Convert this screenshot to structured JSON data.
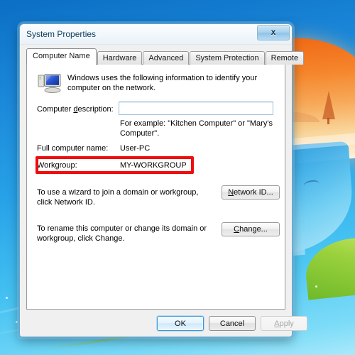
{
  "window": {
    "title": "System Properties",
    "close_label": "x"
  },
  "tabs": [
    {
      "label": "Computer Name",
      "active": true
    },
    {
      "label": "Hardware",
      "active": false
    },
    {
      "label": "Advanced",
      "active": false
    },
    {
      "label": "System Protection",
      "active": false
    },
    {
      "label": "Remote",
      "active": false
    }
  ],
  "panel": {
    "icon": "computer-icon",
    "intro": "Windows uses the following information to identify your computer on the network.",
    "computer_description_label": "Computer description:",
    "computer_description_value": "",
    "computer_description_placeholder": "",
    "example_text": "For example: \"Kitchen Computer\" or \"Mary's Computer\".",
    "full_computer_name_label": "Full computer name:",
    "full_computer_name_value": "User-PC",
    "workgroup_label": "Workgroup:",
    "workgroup_value": "MY-WORKGROUP",
    "network_id_hint": "To use a wizard to join a domain or workgroup, click Network ID.",
    "network_id_button": "Network ID...",
    "change_hint": "To rename this computer or change its domain or workgroup, click Change.",
    "change_button": "Change..."
  },
  "footer": {
    "ok_label": "OK",
    "cancel_label": "Cancel",
    "apply_label": "Apply",
    "apply_disabled": true
  },
  "annotation": {
    "color": "#ee0d0d",
    "targets": "workgroup-row"
  },
  "theme": {
    "accent": "#3c94d4",
    "desktop_blue": "#1a86d8",
    "dialog_face": "#f0f0f0"
  }
}
